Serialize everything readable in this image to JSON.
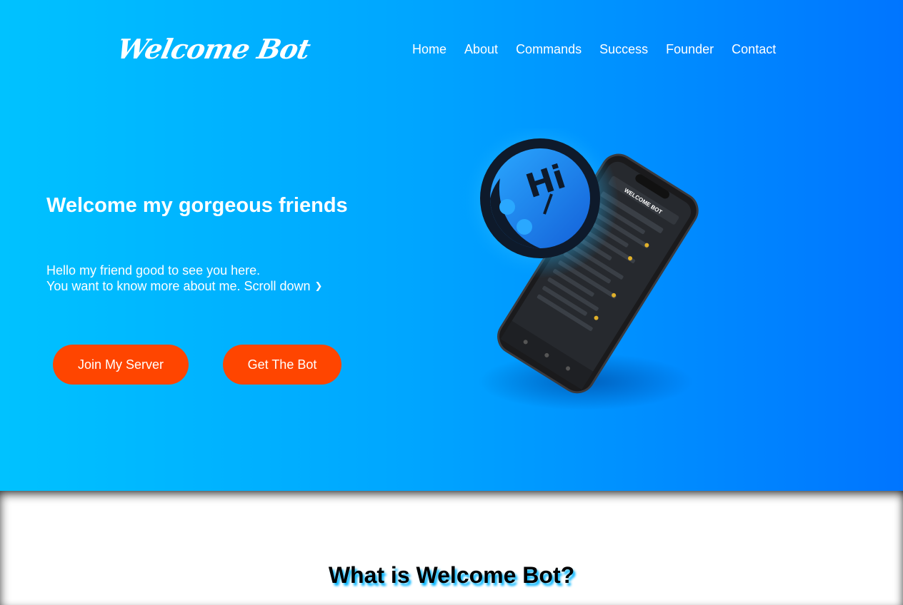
{
  "header": {
    "logo": "Welcome Bot",
    "nav": [
      "Home",
      "About",
      "Commands",
      "Success",
      "Founder",
      "Contact"
    ]
  },
  "hero": {
    "headline": "Welcome my gorgeous friends",
    "line1": "Hello my friend good to see you here.",
    "line2": "You want to know more about me. Scroll down",
    "scroll_icon": "double-chevron-down-icon",
    "join_button": "Join My Server",
    "bot_button": "Get The Bot",
    "badge_text": "Hi",
    "phone_title": "WELCOME BOT"
  },
  "section": {
    "title": "What is Welcome Bot?"
  },
  "colors": {
    "hero_start": "#00c2ff",
    "hero_end": "#0075ff",
    "button": "#ff4500",
    "title_shadow": "#00b4ff"
  }
}
